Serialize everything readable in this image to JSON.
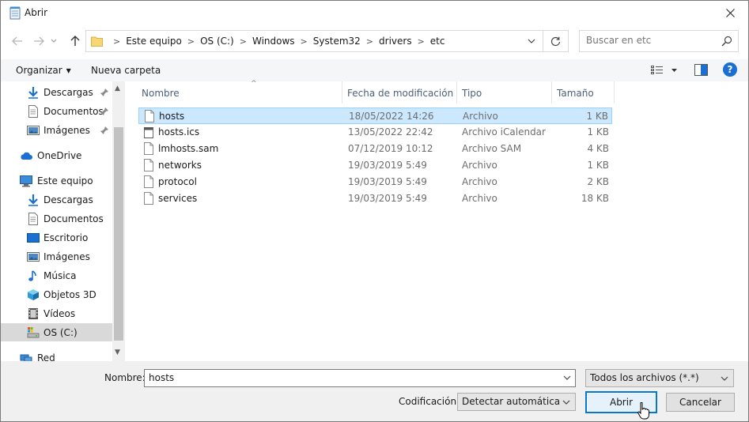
{
  "window": {
    "title": "Abrir"
  },
  "address": {
    "crumbs": [
      "Este equipo",
      "OS (C:)",
      "Windows",
      "System32",
      "drivers",
      "etc"
    ]
  },
  "search": {
    "placeholder": "Buscar en etc"
  },
  "toolbar": {
    "organize_label": "Organizar",
    "new_folder_label": "Nueva carpeta"
  },
  "nav": {
    "quick_access": [
      {
        "label": "Descargas",
        "icon": "download-icon"
      },
      {
        "label": "Documentos",
        "icon": "document-icon"
      },
      {
        "label": "Imágenes",
        "icon": "pictures-icon"
      }
    ],
    "onedrive": "OneDrive",
    "this_pc": "Este equipo",
    "pc_items": [
      {
        "label": "Descargas",
        "icon": "download-icon"
      },
      {
        "label": "Documentos",
        "icon": "document-icon"
      },
      {
        "label": "Escritorio",
        "icon": "desktop-icon"
      },
      {
        "label": "Imágenes",
        "icon": "pictures-icon"
      },
      {
        "label": "Música",
        "icon": "music-icon"
      },
      {
        "label": "Objetos 3D",
        "icon": "3d-objects-icon"
      },
      {
        "label": "Vídeos",
        "icon": "video-icon"
      },
      {
        "label": "OS (C:)",
        "icon": "drive-icon"
      }
    ],
    "network": "Red"
  },
  "columns": {
    "name": "Nombre",
    "date": "Fecha de modificación",
    "type": "Tipo",
    "size": "Tamaño"
  },
  "files": [
    {
      "name": "hosts",
      "date": "18/05/2022 14:26",
      "type": "Archivo",
      "size": "1 KB",
      "selected": true
    },
    {
      "name": "hosts.ics",
      "date": "13/05/2022 22:42",
      "type": "Archivo iCalendar",
      "size": "1 KB",
      "selected": false
    },
    {
      "name": "lmhosts.sam",
      "date": "07/12/2019 10:12",
      "type": "Archivo SAM",
      "size": "4 KB",
      "selected": false
    },
    {
      "name": "networks",
      "date": "19/03/2019 5:49",
      "type": "Archivo",
      "size": "1 KB",
      "selected": false
    },
    {
      "name": "protocol",
      "date": "19/03/2019 5:49",
      "type": "Archivo",
      "size": "2 KB",
      "selected": false
    },
    {
      "name": "services",
      "date": "19/03/2019 5:49",
      "type": "Archivo",
      "size": "18 KB",
      "selected": false
    }
  ],
  "bottom": {
    "filename_label": "Nombre:",
    "filename_value": "hosts",
    "filetype_value": "Todos los archivos  (*.*)",
    "encoding_label": "Codificación:",
    "encoding_value": "Detectar automáticamente",
    "open_label": "Abrir",
    "cancel_label": "Cancelar"
  },
  "colors": {
    "selection": "#cce8ff",
    "selection_border": "#99d1ff",
    "accent": "#0078d7"
  }
}
